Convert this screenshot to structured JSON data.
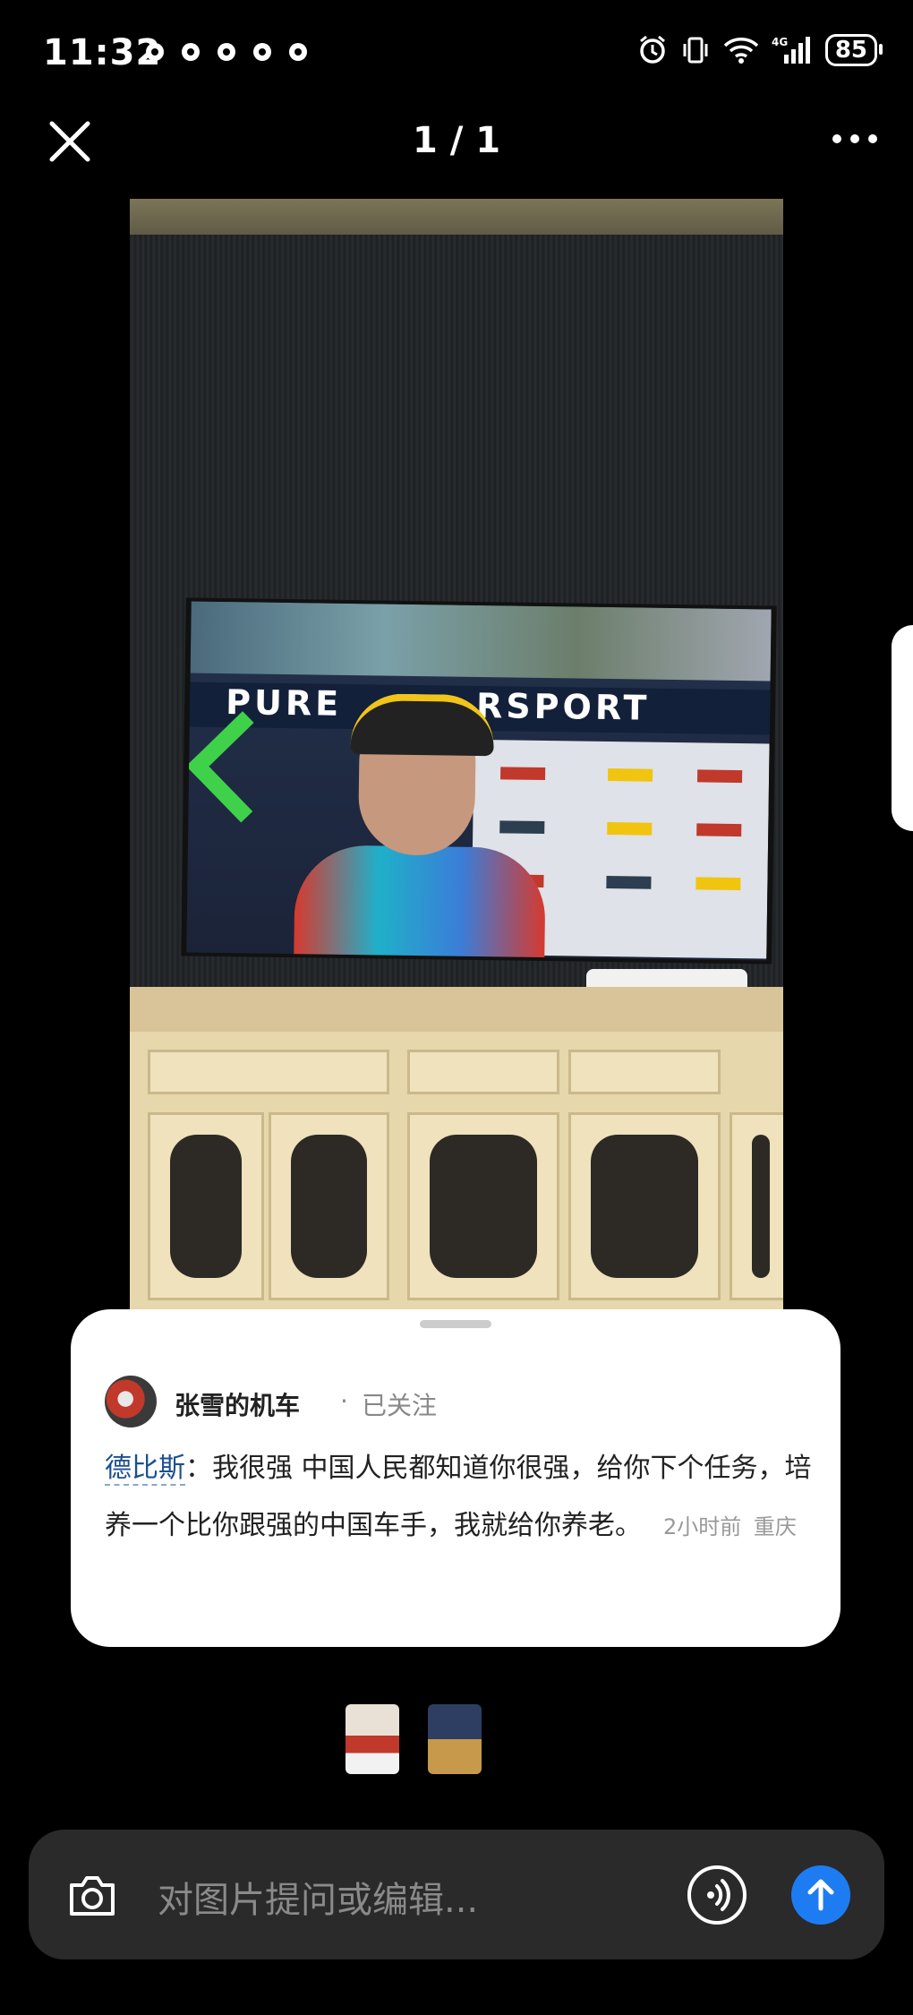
{
  "status_bar": {
    "time": "11:32",
    "battery": "85",
    "network": "4G"
  },
  "header": {
    "counter": "1 / 1"
  },
  "comment_card": {
    "author": "张雪的机车",
    "separator": "·",
    "follow_status": "已关注",
    "mention": "德比斯",
    "colon": "：",
    "text": "我很强 中国人民都知道你很强，给你下个任务，培养一个比你跟强的中国车手，我就给你养老。",
    "time": "2小时前",
    "location": "重庆"
  },
  "photo": {
    "tv_banner_left": "PURE",
    "tv_banner_right": "RSPORT"
  },
  "input": {
    "placeholder": "对图片提问或编辑..."
  },
  "colors": {
    "accent": "#1e7cf2",
    "mention": "#1c4f91",
    "background": "#000000"
  }
}
